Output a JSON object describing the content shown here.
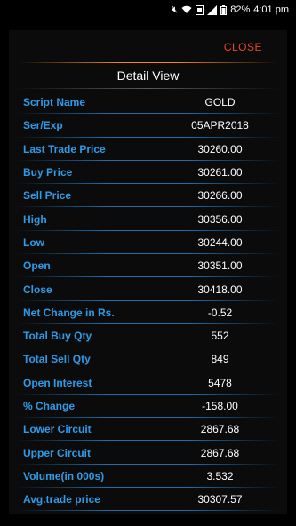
{
  "status": {
    "battery": "82%",
    "time": "4:01 pm",
    "icons": [
      "mute-icon",
      "wifi-icon",
      "vpn-icon",
      "signal-icon",
      "battery-icon"
    ]
  },
  "dialog": {
    "close_label": "CLOSE",
    "title": "Detail View",
    "rows": [
      {
        "label": "Script Name",
        "value": "GOLD"
      },
      {
        "label": "Ser/Exp",
        "value": "05APR2018"
      },
      {
        "label": "Last Trade Price",
        "value": "30260.00"
      },
      {
        "label": "Buy Price",
        "value": "30261.00"
      },
      {
        "label": "Sell Price",
        "value": "30266.00"
      },
      {
        "label": "High",
        "value": "30356.00"
      },
      {
        "label": "Low",
        "value": "30244.00"
      },
      {
        "label": "Open",
        "value": "30351.00"
      },
      {
        "label": "Close",
        "value": "30418.00"
      },
      {
        "label": "Net Change in Rs.",
        "value": "-0.52"
      },
      {
        "label": "Total Buy Qty",
        "value": "552"
      },
      {
        "label": "Total Sell Qty",
        "value": "849"
      },
      {
        "label": "Open Interest",
        "value": "5478"
      },
      {
        "label": "% Change",
        "value": "-158.00"
      },
      {
        "label": "Lower Circuit",
        "value": "2867.68"
      },
      {
        "label": "Upper Circuit",
        "value": "2867.68"
      },
      {
        "label": "Volume(in 000s)",
        "value": "3.532"
      },
      {
        "label": "Avg.trade price",
        "value": "30307.57"
      }
    ]
  },
  "colors": {
    "label": "#2f9be8",
    "accent": "#ff8a00",
    "close": "#e8452f"
  }
}
